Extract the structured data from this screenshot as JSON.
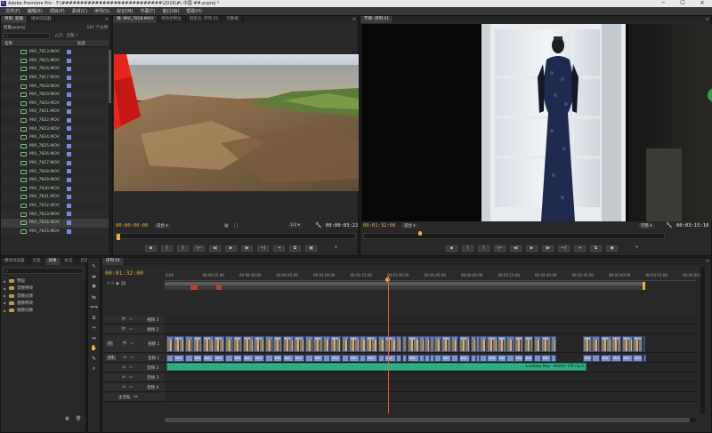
{
  "window": {
    "title": "Adobe Premiere Pro - F:\\###########################\\2016\\#\\ 中国 ##.prproj *",
    "controls": [
      "─",
      "☐",
      "✕"
    ]
  },
  "menu": [
    "文件(F)",
    "编辑(E)",
    "项目(P)",
    "素材(C)",
    "序列(S)",
    "标记(M)",
    "字幕(T)",
    "窗口(W)",
    "帮助(H)"
  ],
  "project_panel": {
    "tabs": [
      "项目: 剪辑",
      "媒体浏览器",
      "信息",
      "效果",
      "标记",
      "历史"
    ],
    "project_name": "剪辑.prproj",
    "item_count": "187 个分项",
    "in_label": "入口：",
    "in_value": "全部",
    "col_name": "名称",
    "col_label": "标签",
    "clips": [
      "MVI_7813.MOV",
      "MVI_7815.MOV",
      "MVI_7816.MOV",
      "MVI_7817.MOV",
      "MVI_7818.MOV",
      "MVI_7819.MOV",
      "MVI_7820.MOV",
      "MVI_7821.MOV",
      "MVI_7822.MOV",
      "MVI_7823.MOV",
      "MVI_7824.MOV",
      "MVI_7825.MOV",
      "MVI_7826.MOV",
      "MVI_7827.MOV",
      "MVI_7828.MOV",
      "MVI_7829.MOV",
      "MVI_7830.MOV",
      "MVI_7831.MOV",
      "MVI_7832.MOV",
      "MVI_7833.MOV",
      "MVI_7834.MOV",
      "MVI_7835.MOV"
    ]
  },
  "effects_panel": {
    "tabs": [
      "媒体浏览器",
      "信息",
      "效果",
      "标记",
      "历史"
    ],
    "folders": [
      "预设",
      "音频特效",
      "音频过渡",
      "视频特效",
      "视频切换"
    ]
  },
  "source_monitor": {
    "tabs": [
      "源: MVI_7828.MOV",
      "特效控制台",
      "调音台: 序列 01",
      "元数据"
    ],
    "timecode_in": "00:00:00:00",
    "fit": "适合",
    "ratio": "1/2",
    "duration": "00:00:03:22"
  },
  "program_monitor": {
    "tabs": [
      "节目: 序列 01"
    ],
    "timecode": "00:01:32:00",
    "fit": "适合",
    "quality": "完整",
    "duration": "00:03:15:10"
  },
  "transport_buttons": [
    "◆",
    "{",
    "}",
    "{←",
    "◀|",
    "▶",
    "|▶",
    "→}",
    "⇥",
    "⧉",
    "▣",
    "+"
  ],
  "timeline": {
    "tab": "序列 01",
    "timecode": "00:01:32:00",
    "ruler": [
      "0:00",
      "00:00:15:00",
      "00:00:30:00",
      "00:00:45:00",
      "00:01:00:00",
      "00:01:15:00",
      "00:01:30:00",
      "00:01:45:00",
      "00:02:00:00",
      "00:02:15:00",
      "00:02:30:00",
      "00:02:45:00",
      "00:03:00:00",
      "00:03:15:00",
      "00:03:30:00"
    ],
    "tracks": {
      "v3": "视频 3",
      "v2": "视频 2",
      "v1": "视频 1",
      "a1": "音频 1",
      "a2": "音频 2",
      "a3": "音频 3",
      "a4": "音频 4",
      "master": "主音轨",
      "v1_tag": "V",
      "a1_tag": "A1"
    },
    "clip_label": "MVI",
    "audio2_clip": "Lindsey Ray - Better Off.mp3"
  },
  "tools": [
    "↖",
    "⇹",
    "✥",
    "⇆",
    "⟺",
    "⧄",
    "⇿",
    "↔",
    "✋",
    "✎",
    "⌕"
  ],
  "colors": {
    "accent_yellow": "#e3b23c",
    "clip_blue": "#6f83b6",
    "audio_green": "#2fb98b",
    "playhead": "#e05a3a"
  }
}
